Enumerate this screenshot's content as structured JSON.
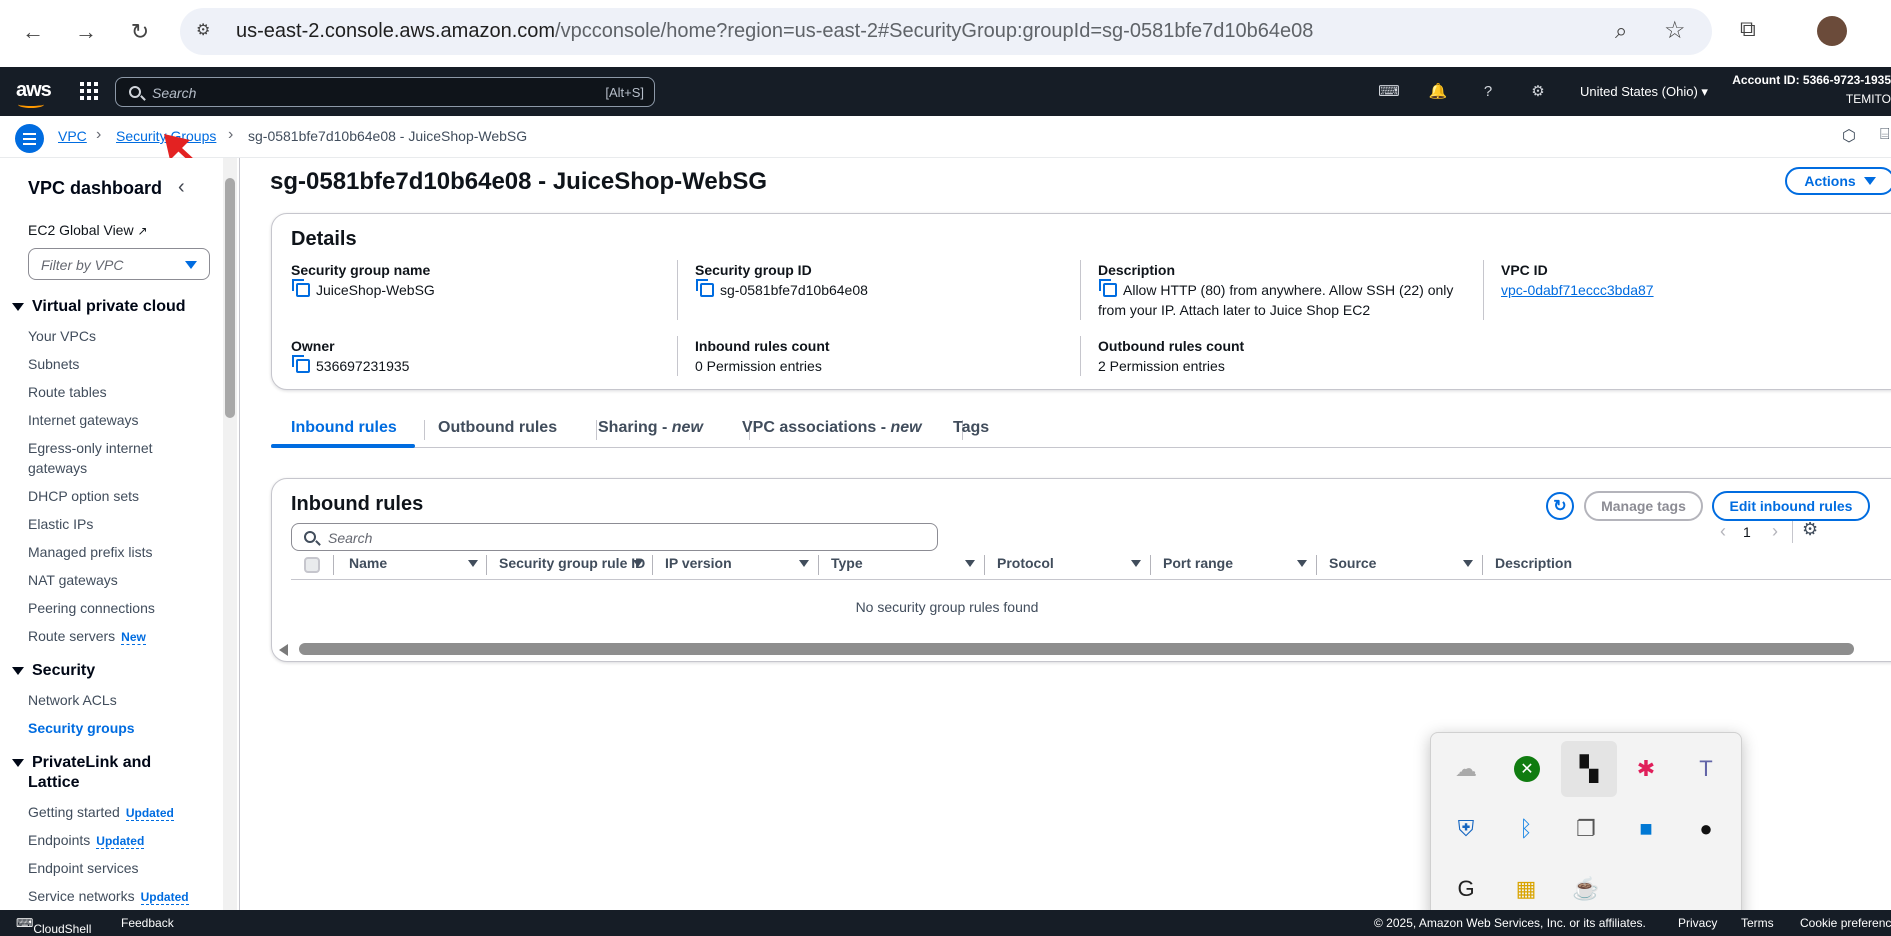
{
  "browser": {
    "url_host": "us-east-2.console.aws.amazon.com",
    "url_path": "/vpcconsole/home?region=us-east-2#SecurityGroup:groupId=sg-0581bfe7d10b64e08"
  },
  "topnav": {
    "logo": "aws",
    "search_placeholder": "Search",
    "search_shortcut": "[Alt+S]",
    "region": "United States (Ohio)",
    "account": "Account ID: 5366-9723-1935",
    "user": "TEMITO"
  },
  "breadcrumb": {
    "items": [
      "VPC",
      "Security Groups",
      "sg-0581bfe7d10b64e08 - JuiceShop-WebSG"
    ]
  },
  "sidenav": {
    "title": "VPC dashboard",
    "ec2_global_view": "EC2 Global View",
    "filter_placeholder": "Filter by VPC",
    "sections": [
      {
        "heading": "Virtual private cloud",
        "items": [
          "Your VPCs",
          "Subnets",
          "Route tables",
          "Internet gateways",
          "Egress-only internet",
          "gateways",
          "DHCP option sets",
          "Elastic IPs",
          "Managed prefix lists",
          "NAT gateways",
          "Peering connections",
          "Route servers"
        ]
      },
      {
        "heading": "Security",
        "items": [
          "Network ACLs",
          "Security groups"
        ]
      },
      {
        "heading": "PrivateLink and",
        "heading2": "Lattice",
        "items": [
          "Getting started",
          "Endpoints",
          "Endpoint services",
          "Service networks"
        ]
      }
    ],
    "tag_new": "New",
    "tag_updated": "Updated"
  },
  "page": {
    "title": "sg-0581bfe7d10b64e08 - JuiceShop-WebSG",
    "actions": "Actions"
  },
  "details": {
    "heading": "Details",
    "sg_name_label": "Security group name",
    "sg_name": "JuiceShop-WebSG",
    "sg_id_label": "Security group ID",
    "sg_id": "sg-0581bfe7d10b64e08",
    "desc_label": "Description",
    "desc_line1": "Allow HTTP (80) from anywhere. Allow SSH (22) only",
    "desc_line2": "from your IP. Attach later to Juice Shop EC2",
    "vpc_label": "VPC ID",
    "vpc_id": "vpc-0dabf71eccc3bda87",
    "owner_label": "Owner",
    "owner": "536697231935",
    "inbound_count_label": "Inbound rules count",
    "inbound_count": "0 Permission entries",
    "outbound_count_label": "Outbound rules count",
    "outbound_count": "2 Permission entries"
  },
  "tabs": {
    "inbound": "Inbound rules",
    "outbound": "Outbound rules",
    "sharing": "Sharing - ",
    "sharing_new": "new",
    "vpc_assoc": "VPC associations - ",
    "vpc_assoc_new": "new",
    "tags": "Tags"
  },
  "rules": {
    "heading": "Inbound rules",
    "manage_tags": "Manage tags",
    "edit_inbound": "Edit inbound rules",
    "search_placeholder": "Search",
    "page": "1",
    "columns": [
      "Name",
      "Security group rule ID",
      "IP version",
      "Type",
      "Protocol",
      "Port range",
      "Source",
      "Description"
    ],
    "empty": "No security group rules found"
  },
  "footer": {
    "cloudshell": "CloudShell",
    "feedback": "Feedback",
    "copyright": "© 2025, Amazon Web Services, Inc. or its affiliates.",
    "privacy": "Privacy",
    "terms": "Terms",
    "cookie": "Cookie preferences"
  }
}
